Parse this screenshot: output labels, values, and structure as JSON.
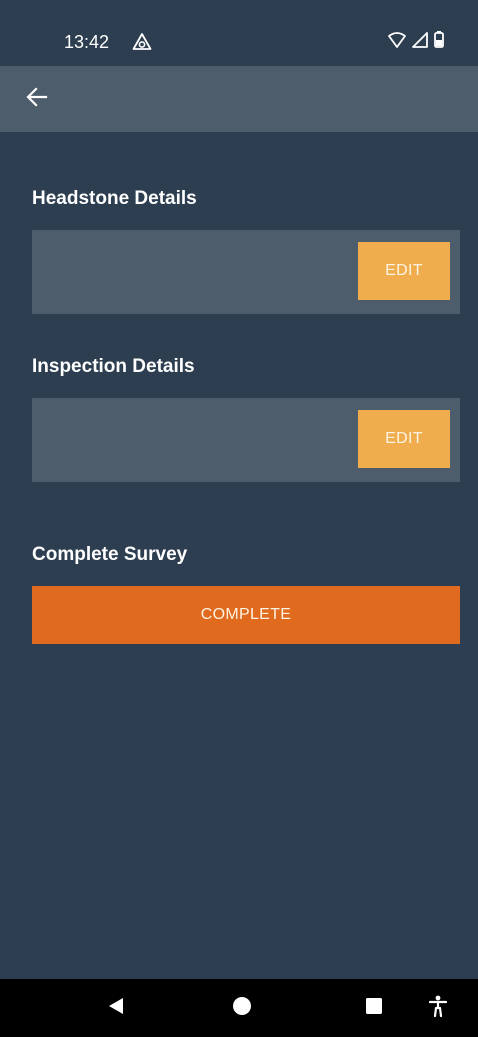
{
  "status_bar": {
    "time": "13:42",
    "app_icon": "warning-triangle-icon",
    "icons": [
      "wifi-icon",
      "signal-icon",
      "battery-icon"
    ]
  },
  "app_bar": {
    "back_icon": "arrow-left-icon"
  },
  "sections": [
    {
      "title": "Headstone Details",
      "button_label": "EDIT"
    },
    {
      "title": "Inspection Details",
      "button_label": "EDIT"
    }
  ],
  "complete_section": {
    "title": "Complete Survey",
    "button_label": "COMPLETE"
  },
  "nav_bar": {
    "items": [
      "back-triangle-icon",
      "home-circle-icon",
      "recents-square-icon",
      "accessibility-icon"
    ]
  },
  "colors": {
    "background": "#2c3e50",
    "card": "#4d5d6b",
    "edit_button": "#f0ad4e",
    "complete_button": "#e06a1e"
  }
}
